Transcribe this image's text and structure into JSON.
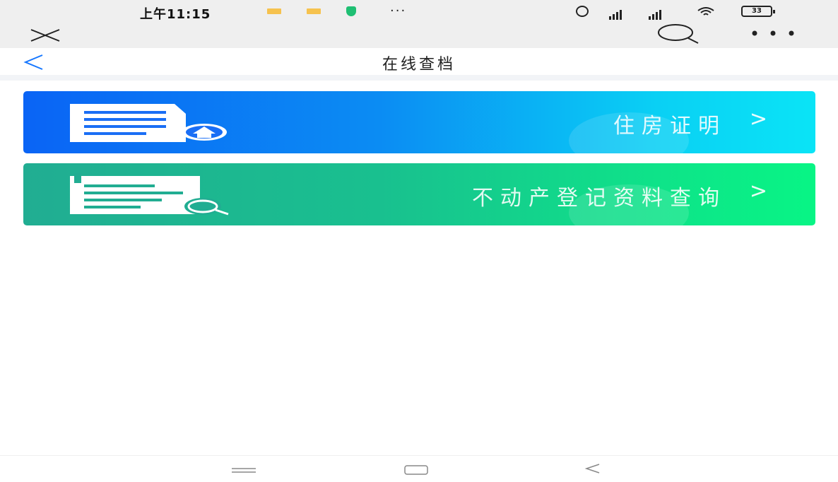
{
  "status_bar": {
    "time": "上午11:15",
    "more": "···",
    "battery": "33"
  },
  "header": {
    "title": "在线查档"
  },
  "cards": [
    {
      "label": "住房证明",
      "arrow": ">",
      "icon": "house-document-icon"
    },
    {
      "label": "不动产登记资料查询",
      "arrow": ">",
      "icon": "document-search-icon"
    }
  ],
  "colors": {
    "card_housing_start": "#0a64f5",
    "card_housing_end": "#0ae4f6",
    "card_records_start": "#21ad92",
    "card_records_end": "#08f585",
    "back_arrow": "#1677ff"
  }
}
